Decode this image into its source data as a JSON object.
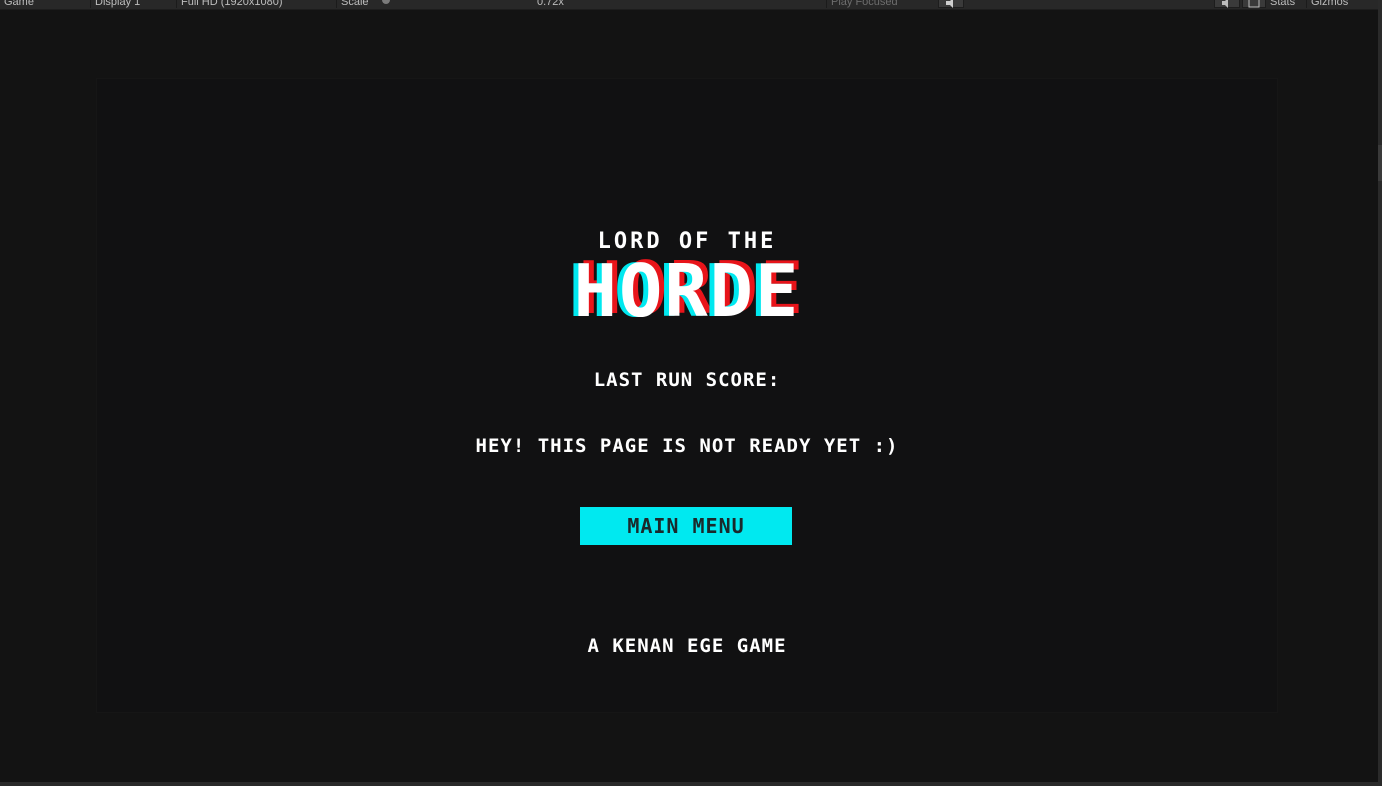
{
  "toolbar": {
    "view_tab": "Game",
    "display": "Display 1",
    "resolution": "Full HD (1920x1080)",
    "scale_label": "Scale",
    "scale_value": "0.72x",
    "play_mode": "Play Focused",
    "stats": "Stats",
    "gizmos": "Gizmos"
  },
  "game": {
    "title_top": "LORD OF THE",
    "title_main": "HORDE",
    "score_label": "LAST RUN SCORE:",
    "message": "HEY! THIS PAGE IS NOT READY YET :)",
    "main_menu_button": "MAIN MENU",
    "credit": "A KENAN EGE GAME"
  },
  "colors": {
    "accent_cyan": "#00e9f0",
    "accent_red": "#e8141a",
    "background": "#111112"
  }
}
